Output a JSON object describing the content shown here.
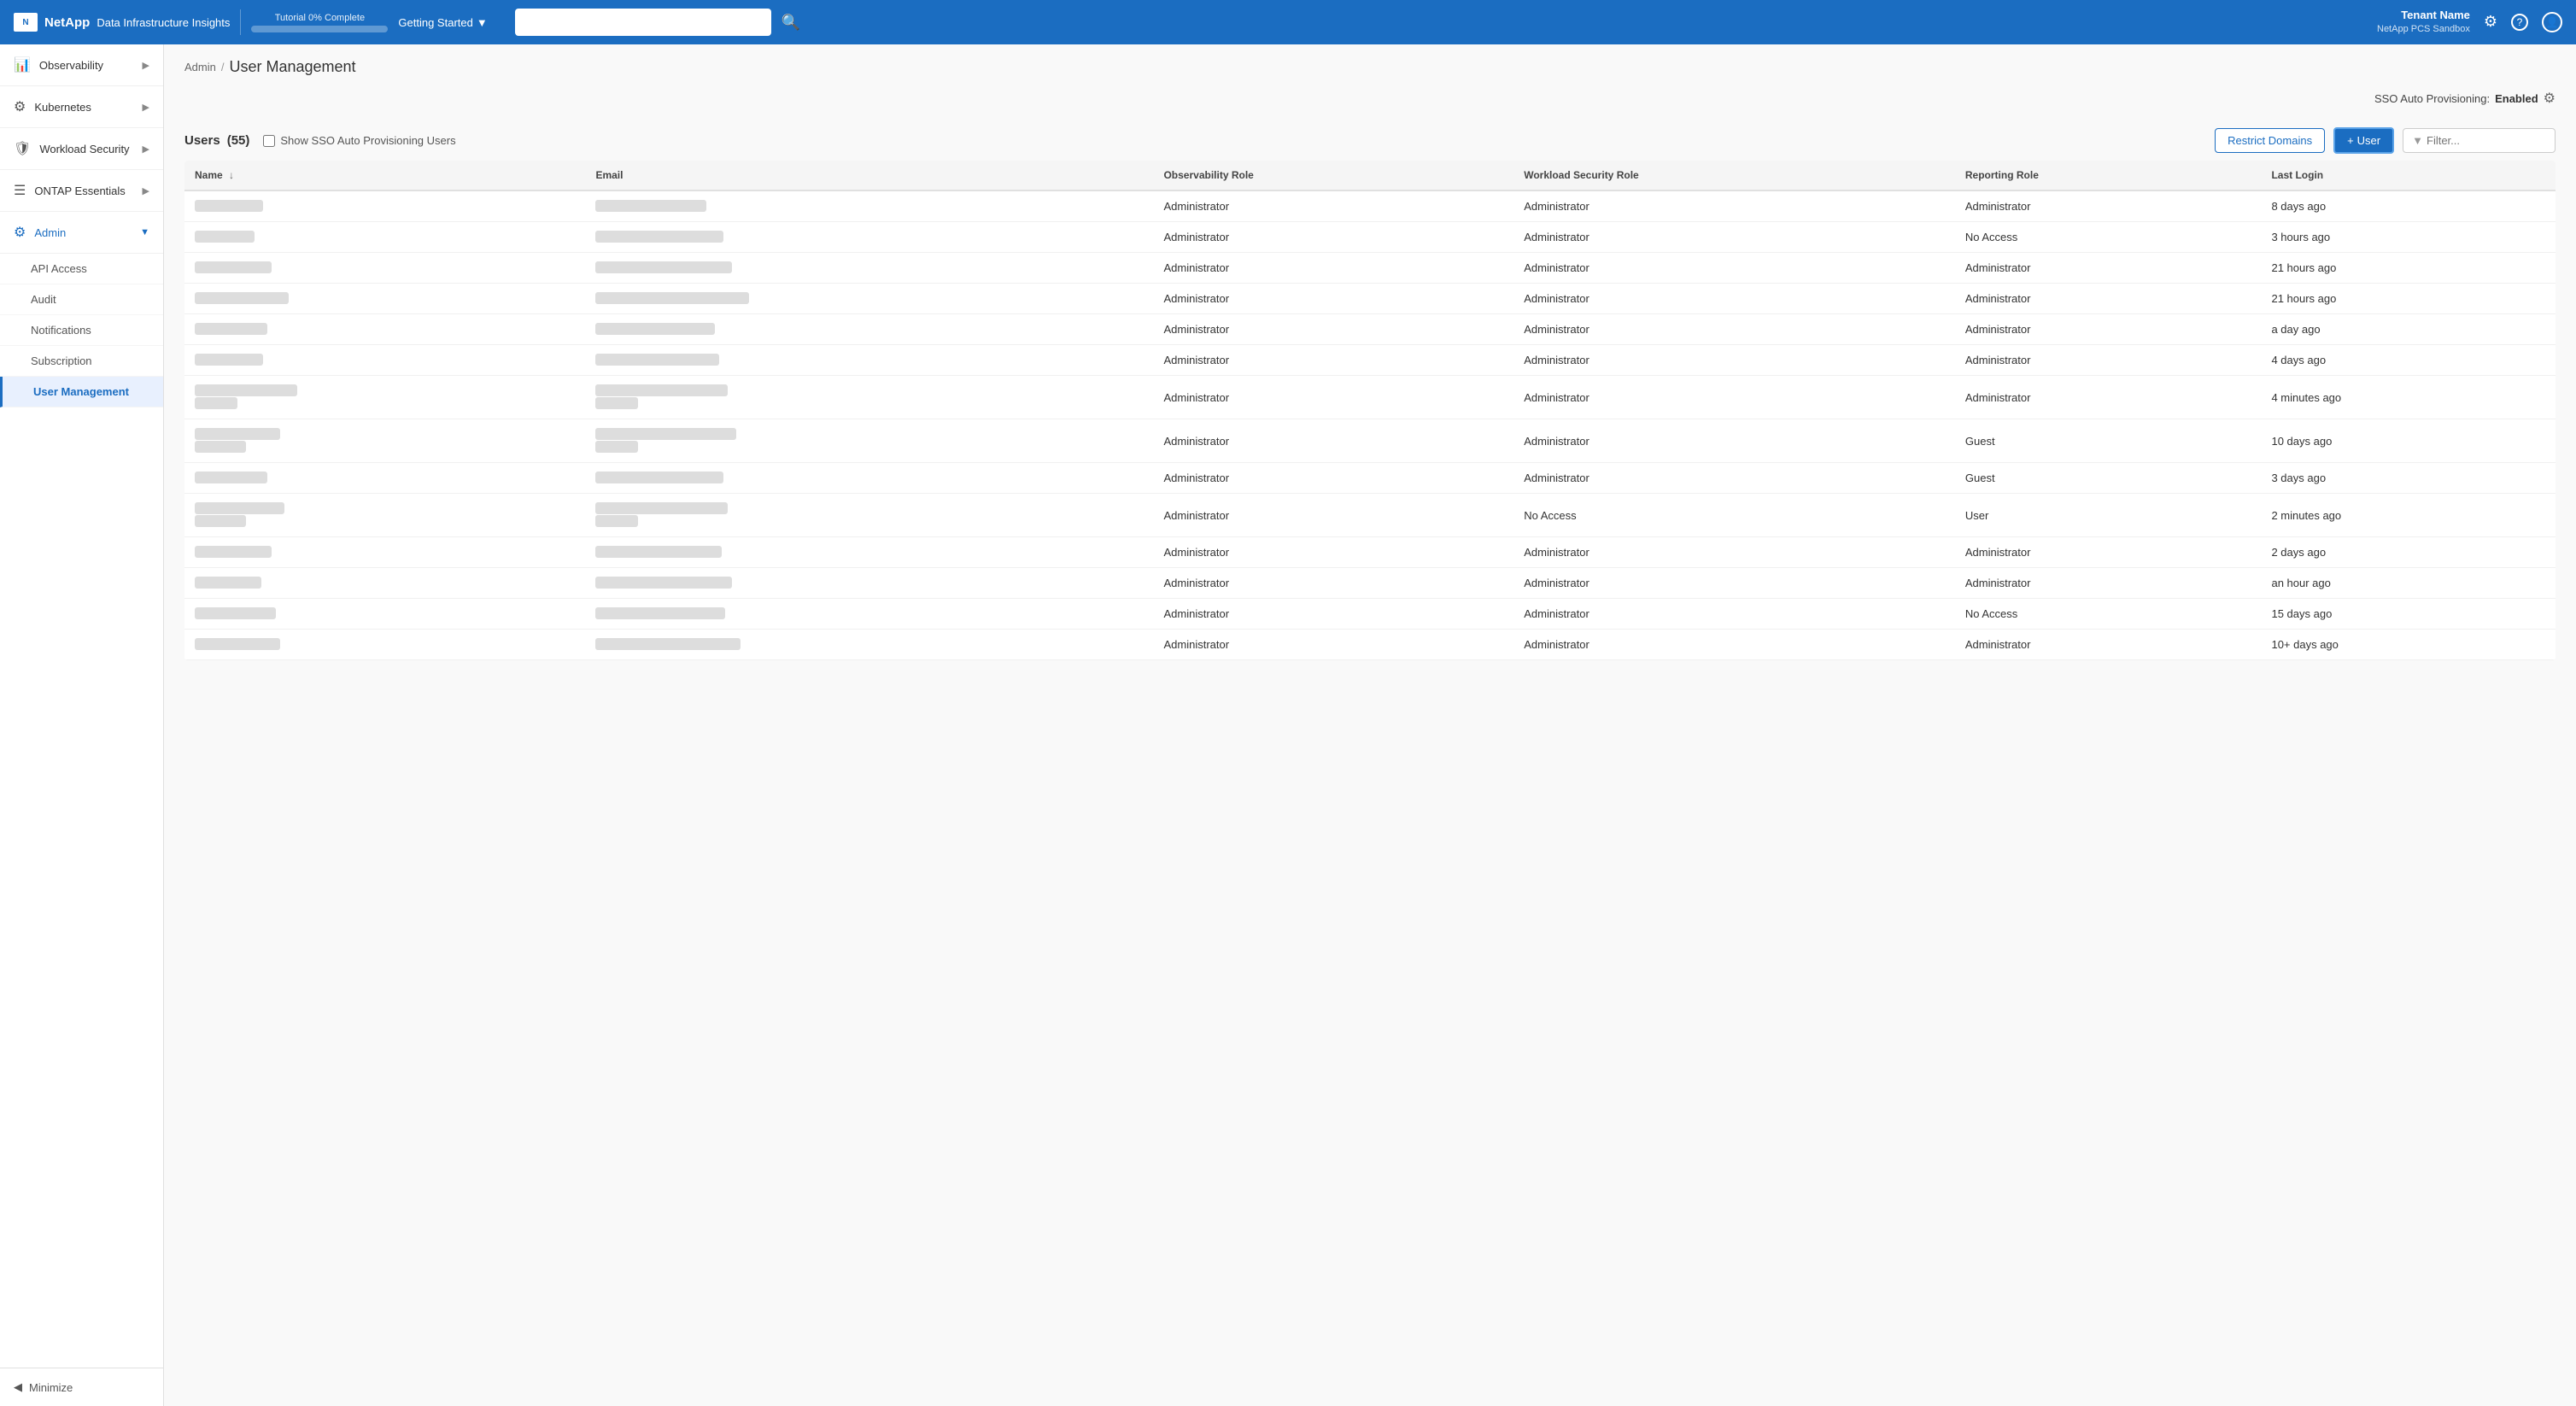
{
  "header": {
    "logo_text": "NetApp",
    "app_name": "Data Infrastructure Insights",
    "tutorial_label": "Tutorial 0% Complete",
    "tutorial_pct": 0,
    "getting_started": "Getting Started",
    "search_placeholder": "",
    "tenant_name": "Tenant Name",
    "tenant_sub": "NetApp PCS Sandbox"
  },
  "sidebar": {
    "items": [
      {
        "id": "observability",
        "label": "Observability",
        "icon": "📊",
        "has_chevron": true
      },
      {
        "id": "kubernetes",
        "label": "Kubernetes",
        "icon": "⚙",
        "has_chevron": true
      },
      {
        "id": "workload-security",
        "label": "Workload Security",
        "icon": "🛡",
        "has_chevron": true
      },
      {
        "id": "ontap-essentials",
        "label": "ONTAP Essentials",
        "icon": "☰",
        "has_chevron": true
      },
      {
        "id": "admin",
        "label": "Admin",
        "icon": "⚙",
        "has_chevron": true,
        "active": true
      }
    ],
    "sub_items": [
      {
        "id": "api-access",
        "label": "API Access"
      },
      {
        "id": "audit",
        "label": "Audit"
      },
      {
        "id": "notifications",
        "label": "Notifications"
      },
      {
        "id": "subscription",
        "label": "Subscription"
      },
      {
        "id": "user-management",
        "label": "User Management",
        "active": true
      }
    ],
    "minimize_label": "Minimize"
  },
  "breadcrumb": {
    "parent": "Admin",
    "separator": "/",
    "current": "User Management"
  },
  "page": {
    "sso_label": "SSO Auto Provisioning:",
    "sso_status": "Enabled",
    "users_title": "Users",
    "users_count": "(55)",
    "show_sso_label": "Show SSO Auto Provisioning Users",
    "restrict_domains_label": "Restrict Domains",
    "add_user_label": "+ User",
    "filter_placeholder": "Filter..."
  },
  "table": {
    "columns": [
      {
        "id": "name",
        "label": "Name",
        "sortable": true
      },
      {
        "id": "email",
        "label": "Email"
      },
      {
        "id": "observability_role",
        "label": "Observability Role"
      },
      {
        "id": "workload_security_role",
        "label": "Workload Security Role"
      },
      {
        "id": "reporting_role",
        "label": "Reporting Role"
      },
      {
        "id": "last_login",
        "label": "Last Login"
      }
    ],
    "rows": [
      {
        "name_w": 80,
        "email_w": 130,
        "obs_role": "Administrator",
        "ws_role": "Administrator",
        "rep_role": "Administrator",
        "last_login": "8 days ago"
      },
      {
        "name_w": 70,
        "email_w": 150,
        "obs_role": "Administrator",
        "ws_role": "Administrator",
        "rep_role": "No Access",
        "last_login": "3 hours ago"
      },
      {
        "name_w": 90,
        "email_w": 160,
        "obs_role": "Administrator",
        "ws_role": "Administrator",
        "rep_role": "Administrator",
        "last_login": "21 hours ago"
      },
      {
        "name_w": 110,
        "email_w": 180,
        "obs_role": "Administrator",
        "ws_role": "Administrator",
        "rep_role": "Administrator",
        "last_login": "21 hours ago"
      },
      {
        "name_w": 85,
        "email_w": 140,
        "obs_role": "Administrator",
        "ws_role": "Administrator",
        "rep_role": "Administrator",
        "last_login": "a day ago"
      },
      {
        "name_w": 80,
        "email_w": 145,
        "obs_role": "Administrator",
        "ws_role": "Administrator",
        "rep_role": "Administrator",
        "last_login": "4 days ago"
      },
      {
        "name_w": 120,
        "email_w": 155,
        "obs_role": "Administrator",
        "ws_role": "Administrator",
        "rep_role": "Administrator",
        "last_login": "4 minutes ago"
      },
      {
        "name_w": 100,
        "email_w": 165,
        "obs_role": "Administrator",
        "ws_role": "Administrator",
        "rep_role": "Guest",
        "last_login": "10 days ago"
      },
      {
        "name_w": 85,
        "email_w": 150,
        "obs_role": "Administrator",
        "ws_role": "Administrator",
        "rep_role": "Guest",
        "last_login": "3 days ago"
      },
      {
        "name_w": 105,
        "email_w": 155,
        "obs_role": "Administrator",
        "ws_role": "No Access",
        "rep_role": "User",
        "last_login": "2 minutes ago"
      },
      {
        "name_w": 90,
        "email_w": 148,
        "obs_role": "Administrator",
        "ws_role": "Administrator",
        "rep_role": "Administrator",
        "last_login": "2 days ago"
      },
      {
        "name_w": 78,
        "email_w": 160,
        "obs_role": "Administrator",
        "ws_role": "Administrator",
        "rep_role": "Administrator",
        "last_login": "an hour ago"
      },
      {
        "name_w": 95,
        "email_w": 152,
        "obs_role": "Administrator",
        "ws_role": "Administrator",
        "rep_role": "No Access",
        "last_login": "15 days ago"
      },
      {
        "name_w": 100,
        "email_w": 170,
        "obs_role": "Administrator",
        "ws_role": "Administrator",
        "rep_role": "Administrator",
        "last_login": "10+ days ago"
      }
    ]
  },
  "icons": {
    "chevron_right": "▶",
    "chevron_down": "▼",
    "chevron_left": "◀",
    "search": "🔍",
    "settings": "⚙",
    "help": "?",
    "user": "👤",
    "sort_down": "↓",
    "filter": "▼",
    "minimize": "◀",
    "plus": "+"
  },
  "colors": {
    "primary": "#1b6dc1",
    "header_bg": "#1b6dc1",
    "active_menu_bg": "#e8f0fe",
    "active_menu_text": "#1b6dc1"
  }
}
